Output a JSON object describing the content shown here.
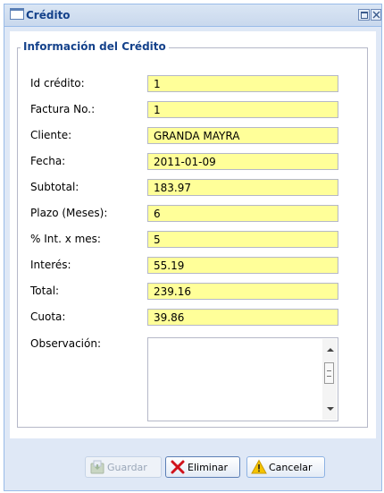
{
  "window": {
    "title": "Crédito"
  },
  "form": {
    "legend": "Información del Crédito",
    "fields": [
      {
        "label": "Id crédito:",
        "value": "1"
      },
      {
        "label": "Factura No.:",
        "value": "1"
      },
      {
        "label": "Cliente:",
        "value": "GRANDA MAYRA"
      },
      {
        "label": "Fecha:",
        "value": "2011-01-09"
      },
      {
        "label": "Subtotal:",
        "value": "183.97"
      },
      {
        "label": "Plazo (Meses):",
        "value": "6"
      },
      {
        "label": "% Int. x mes:",
        "value": "5"
      },
      {
        "label": "Interés:",
        "value": "55.19"
      },
      {
        "label": "Total:",
        "value": "239.16"
      },
      {
        "label": "Cuota:",
        "value": "39.86"
      }
    ],
    "observacion": {
      "label": "Observación:",
      "value": ""
    }
  },
  "buttons": {
    "guardar": "Guardar",
    "eliminar": "Eliminar",
    "cancelar": "Cancelar"
  },
  "colors": {
    "field_background": "#ffff99",
    "title_text": "#15428b",
    "window_frame": "#dfe8f6"
  }
}
